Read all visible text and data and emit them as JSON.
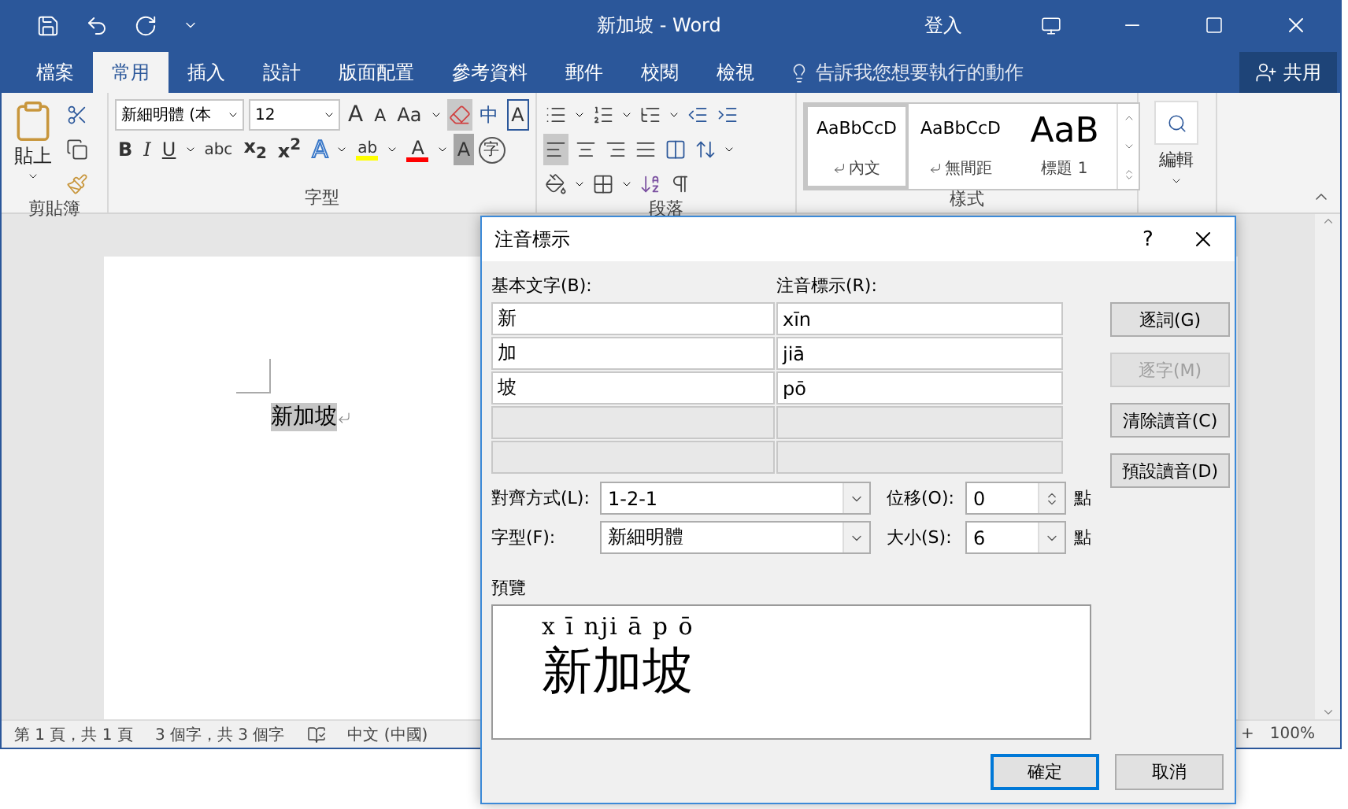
{
  "window": {
    "title": "新加坡 - Word",
    "sign_in": "登入"
  },
  "tabs": [
    {
      "label": "檔案",
      "selected": false
    },
    {
      "label": "常用",
      "selected": true
    },
    {
      "label": "插入",
      "selected": false
    },
    {
      "label": "設計",
      "selected": false
    },
    {
      "label": "版面配置",
      "selected": false
    },
    {
      "label": "參考資料",
      "selected": false
    },
    {
      "label": "郵件",
      "selected": false
    },
    {
      "label": "校閱",
      "selected": false
    },
    {
      "label": "檢視",
      "selected": false
    }
  ],
  "tell_me": {
    "placeholder": "告訴我您想要執行的動作"
  },
  "share_button": "共用",
  "ribbon": {
    "clipboard": {
      "paste": "貼上",
      "label": "剪貼簿"
    },
    "font": {
      "name": "新細明體 (本",
      "size": "12",
      "label": "字型",
      "row1": [
        {
          "kind": "grow",
          "text": "A"
        },
        {
          "kind": "shrink",
          "text": "A"
        },
        {
          "kind": "case",
          "text": "Aa"
        },
        {
          "kind": "phonetic",
          "text": "中"
        },
        {
          "kind": "boxed",
          "text": "A"
        }
      ],
      "row2": [
        {
          "kind": "bold",
          "text": "B"
        },
        {
          "kind": "italic",
          "text": "I"
        },
        {
          "kind": "underline",
          "text": "U"
        },
        {
          "kind": "strike",
          "text": "abc"
        },
        {
          "kind": "script",
          "text": "x$_{2}$"
        },
        {
          "kind": "script",
          "text": "x$^{2}$"
        },
        {
          "kind": "outline",
          "text": "A"
        },
        {
          "kind": "highlight",
          "text": "ab",
          "color": "#ffff00"
        },
        {
          "kind": "color",
          "text": "A",
          "color": "#ff0000"
        },
        {
          "kind": "shaded",
          "text": "A"
        },
        {
          "kind": "circled",
          "text": "字"
        }
      ]
    },
    "paragraph": {
      "label": "段落"
    },
    "styles": {
      "label": "樣式",
      "items": [
        {
          "sample": "AaBbCcD",
          "name": "內文",
          "kind": "body",
          "selected": true
        },
        {
          "sample": "AaBbCcD",
          "name": "無間距",
          "kind": "body",
          "selected": false
        },
        {
          "sample": "AaB",
          "name": "標題 1",
          "kind": "heading",
          "selected": false
        }
      ]
    },
    "editing": {
      "label": "編輯"
    }
  },
  "document": {
    "text": "新加坡",
    "selected": true
  },
  "status_bar": {
    "items": [
      "第 1 頁，共 1 頁",
      "3 個字，共 3 個字",
      "中文 (中國)"
    ],
    "zoom_in": "+",
    "zoom": "100%"
  },
  "dialog": {
    "title": "注音標示",
    "help": "?",
    "base_header": "基本文字(B):",
    "ruby_header": "注音標示(R):",
    "rows": [
      {
        "base": "新",
        "ruby": "xīn",
        "disabled": false
      },
      {
        "base": "加",
        "ruby": "jiā",
        "disabled": false
      },
      {
        "base": "坡",
        "ruby": "pō",
        "disabled": false
      },
      {
        "disabled": true
      },
      {
        "disabled": true
      }
    ],
    "side_buttons": [
      {
        "label": "逐詞(G)",
        "disabled": false
      },
      {
        "label": "逐字(M)",
        "disabled": true
      },
      {
        "label": "清除讀音(C)",
        "disabled": false
      },
      {
        "label": "預設讀音(D)",
        "disabled": false
      }
    ],
    "alignment": {
      "label": "對齊方式(L):",
      "value": "1-2-1"
    },
    "offset": {
      "label": "位移(O):",
      "value": "0",
      "unit": "點"
    },
    "font": {
      "label": "字型(F):",
      "value": "新細明體"
    },
    "size": {
      "label": "大小(S):",
      "value": "6",
      "unit": "點"
    },
    "preview": {
      "label": "預覽",
      "ruby": "x ī nji ā p ō",
      "text": "新加坡"
    },
    "footer_buttons": [
      {
        "label": "確定",
        "default": true
      },
      {
        "label": "取消",
        "default": false
      }
    ]
  }
}
